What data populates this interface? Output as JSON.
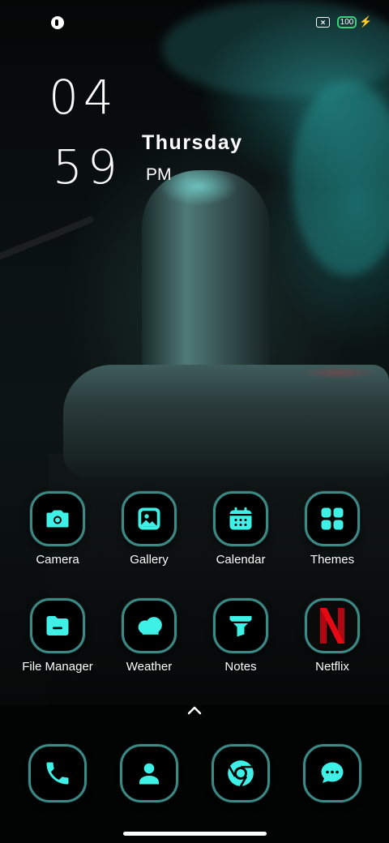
{
  "status_bar": {
    "battery_level": "100",
    "battery_color": "#3ed07a"
  },
  "clock": {
    "hour": "04",
    "minute": "59",
    "day": "Thursday",
    "ampm": "PM"
  },
  "apps": [
    {
      "label": "Camera",
      "icon": "camera-icon"
    },
    {
      "label": "Gallery",
      "icon": "gallery-icon"
    },
    {
      "label": "Calendar",
      "icon": "calendar-icon"
    },
    {
      "label": "Themes",
      "icon": "themes-icon"
    },
    {
      "label": "File Manager",
      "icon": "folder-icon"
    },
    {
      "label": "Weather",
      "icon": "cloud-icon"
    },
    {
      "label": "Notes",
      "icon": "funnel-icon"
    },
    {
      "label": "Netflix",
      "icon": "netflix-icon"
    }
  ],
  "dock": [
    {
      "icon": "phone-icon"
    },
    {
      "icon": "contacts-icon"
    },
    {
      "icon": "chrome-icon"
    },
    {
      "icon": "messages-icon"
    }
  ],
  "theme": {
    "accent": "#3ff0e6",
    "icon_border": "#3c8a86",
    "netflix_red": "#e50914"
  }
}
